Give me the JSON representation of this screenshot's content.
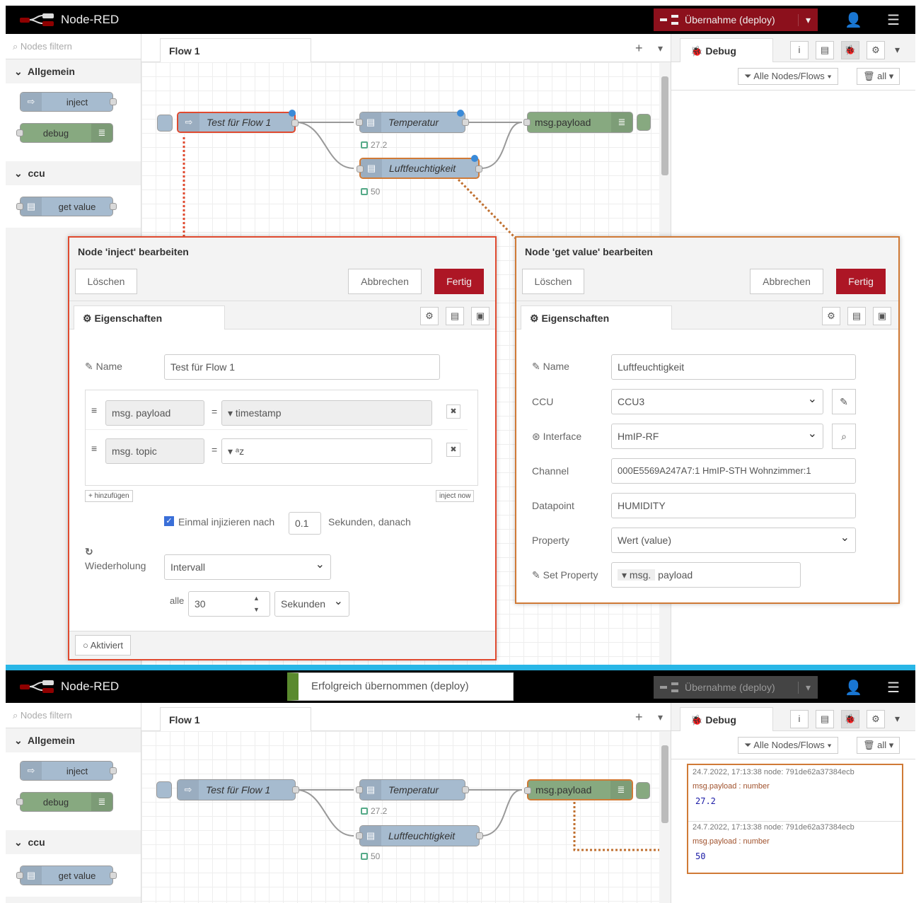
{
  "app": {
    "name": "Node-RED",
    "deploy_label": "Übernahme (deploy)"
  },
  "palette": {
    "filter_placeholder": "Nodes filtern",
    "categories": [
      {
        "label": "Allgemein",
        "nodes": [
          "inject",
          "debug"
        ]
      },
      {
        "label": "ccu",
        "nodes": [
          "get value"
        ]
      }
    ]
  },
  "workspace": {
    "tab": "Flow 1",
    "nodes": {
      "inject": "Test für Flow 1",
      "temp": "Temperatur",
      "temp_status": "27.2",
      "hum": "Luftfeuchtigkeit",
      "hum_status": "50",
      "debug": "msg.payload"
    }
  },
  "sidebar": {
    "tab": "Debug",
    "filter": "Alle Nodes/Flows",
    "clear": "all"
  },
  "inject_dialog": {
    "title": "Node 'inject' bearbeiten",
    "delete": "Löschen",
    "cancel": "Abbrechen",
    "done": "Fertig",
    "tab": "Eigenschaften",
    "name_label": "Name",
    "name_value": "Test für Flow 1",
    "props": [
      {
        "prefix": "msg.",
        "key": "payload",
        "value": "timestamp"
      },
      {
        "prefix": "msg.",
        "key": "topic",
        "value": "ᵃz"
      }
    ],
    "add": "hinzufügen",
    "inject_now": "inject now",
    "once_label": "Einmal injizieren nach",
    "once_value": "0.1",
    "once_suffix": "Sekunden, danach",
    "repeat_label": "Wiederholung",
    "repeat_value": "Intervall",
    "every_label": "alle",
    "every_value": "30",
    "every_unit": "Sekunden",
    "enabled": "Aktiviert"
  },
  "getvalue_dialog": {
    "title": "Node 'get value' bearbeiten",
    "delete": "Löschen",
    "cancel": "Abbrechen",
    "done": "Fertig",
    "tab": "Eigenschaften",
    "fields": [
      {
        "label": "Name",
        "value": "Luftfeuchtigkeit"
      },
      {
        "label": "CCU",
        "value": "CCU3"
      },
      {
        "label": "Interface",
        "value": "HmIP-RF"
      },
      {
        "label": "Channel",
        "value": "000E5569A247A7:1 HmIP-STH Wohnzimmer:1"
      },
      {
        "label": "Datapoint",
        "value": "HUMIDITY"
      },
      {
        "label": "Property",
        "value": "Wert (value)"
      }
    ],
    "set_property_label": "Set Property",
    "set_property_prefix": "msg.",
    "set_property_value": "payload"
  },
  "toast": "Erfolgreich übernommen (deploy)",
  "debug_messages": [
    {
      "meta": "24.7.2022, 17:13:38   node: 791de62a37384ecb",
      "type": "msg.payload : number",
      "value": "27.2"
    },
    {
      "meta": "24.7.2022, 17:13:38   node: 791de62a37384ecb",
      "type": "msg.payload : number",
      "value": "50"
    }
  ],
  "colors": {
    "accent_red": "#ad1625",
    "inject_border": "#e04a2f",
    "getvalue_border": "#d07a36",
    "divider": "#29b6e6"
  }
}
